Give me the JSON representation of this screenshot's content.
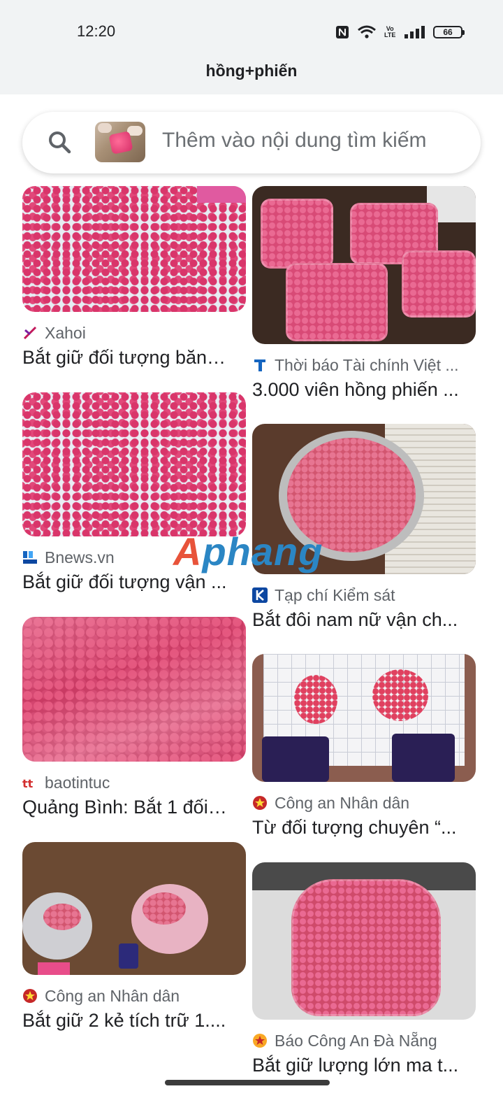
{
  "status_bar": {
    "time": "12:20",
    "icons": [
      "nfc-icon",
      "wifi-icon",
      "volte-icon",
      "signal-icon",
      "battery-icon"
    ],
    "volte_text": "Vo\nLTE",
    "battery_level": "66"
  },
  "header": {
    "query": "hồng+phiến"
  },
  "search": {
    "placeholder": "Thêm vào nội dung tìm kiếm"
  },
  "results": [
    {
      "source": "Xahoi",
      "title": "Bắt giữ đối tượng băng..."
    },
    {
      "source": "Thời báo Tài chính Việt ...",
      "title": "3.000 viên hồng phiến ..."
    },
    {
      "source": "Bnews.vn",
      "title": "Bắt giữ đối tượng vận ..."
    },
    {
      "source": "Tạp chí Kiểm sát",
      "title": "Bắt đôi nam nữ vận ch..."
    },
    {
      "source": "baotintuc",
      "title": "Quảng Bình: Bắt 1 đối t..."
    },
    {
      "source": "Công an Nhân dân",
      "title": "Từ đối tượng chuyên “..."
    },
    {
      "source": "Công an Nhân dân",
      "title": "Bắt giữ 2 kẻ tích trữ 1...."
    },
    {
      "source": "Báo Công An Đà Nẵng",
      "title": "Bắt giữ lượng lớn ma t..."
    }
  ],
  "watermark": {
    "part1": "A",
    "part2": "phang"
  },
  "colors": {
    "header_bg": "#f1f3f4",
    "text_primary": "#202124",
    "text_secondary": "#5f6368"
  }
}
